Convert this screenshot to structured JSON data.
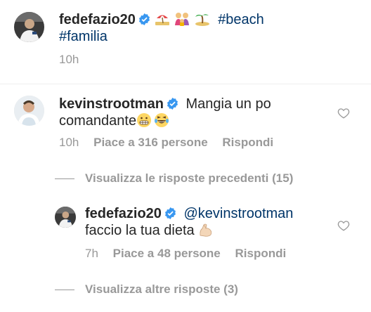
{
  "post": {
    "username": "fedefazio20",
    "caption_tags_line1": "#beach",
    "caption_tags_line2": "#familia",
    "time": "10h"
  },
  "comment": {
    "username": "kevinstrootman",
    "text_line1": "Mangia un po",
    "text_line2": "comandante",
    "time": "10h",
    "likes_label": "Piace a 316 persone",
    "reply_label": "Rispondi"
  },
  "view_previous_replies": "Visualizza le risposte precedenti (15)",
  "reply": {
    "username": "fedefazio20",
    "mention": "@kevinstrootman",
    "text": "faccio la tua dieta",
    "time": "7h",
    "likes_label": "Piace a 48 persone",
    "reply_label": "Rispondi"
  },
  "view_more_replies": "Visualizza altre risposte (3)",
  "colors": {
    "username": "#262626",
    "hashtag": "#003569",
    "meta": "#999999",
    "verified": "#3897f0"
  },
  "icons": [
    "verified-badge-icon",
    "heart-icon",
    "beach-umbrella-emoji",
    "family-emoji",
    "palm-island-emoji",
    "grimacing-emoji",
    "laughing-emoji",
    "flexed-biceps-emoji"
  ]
}
